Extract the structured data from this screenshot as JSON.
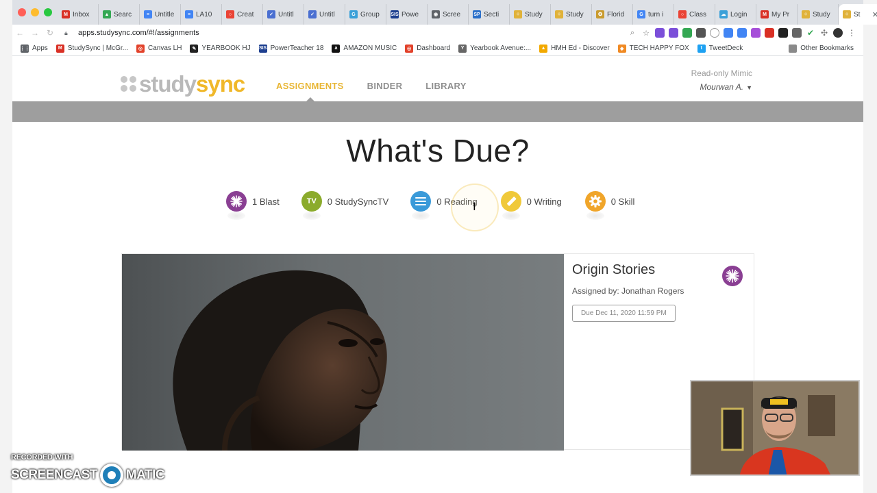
{
  "browser": {
    "tabs": [
      {
        "label": "Inbox",
        "color": "#d93025",
        "glyph": "M"
      },
      {
        "label": "Searc",
        "color": "#34a853",
        "glyph": "▲"
      },
      {
        "label": "Untitle",
        "color": "#4285f4",
        "glyph": "≡"
      },
      {
        "label": "LA10",
        "color": "#4285f4",
        "glyph": "≡"
      },
      {
        "label": "Creat",
        "color": "#ea4335",
        "glyph": "○"
      },
      {
        "label": "Untitl",
        "color": "#4a6fd1",
        "glyph": "✓"
      },
      {
        "label": "Untitl",
        "color": "#4a6fd1",
        "glyph": "✓"
      },
      {
        "label": "Group",
        "color": "#3aa0d8",
        "glyph": "G"
      },
      {
        "label": "Powe",
        "color": "#1d3f8f",
        "glyph": "SIS"
      },
      {
        "label": "Scree",
        "color": "#5f6368",
        "glyph": "◉"
      },
      {
        "label": "Secti",
        "color": "#2a6fc9",
        "glyph": "SP"
      },
      {
        "label": "Study",
        "color": "#e0b23a",
        "glyph": "⁘"
      },
      {
        "label": "Study",
        "color": "#e0b23a",
        "glyph": "⁘"
      },
      {
        "label": "Florid",
        "color": "#c99b2e",
        "glyph": "✪"
      },
      {
        "label": "turn i",
        "color": "#4285f4",
        "glyph": "G"
      },
      {
        "label": "Class",
        "color": "#ea4335",
        "glyph": "○"
      },
      {
        "label": "Login",
        "color": "#3aa0d8",
        "glyph": "☁"
      },
      {
        "label": "My Pr",
        "color": "#d93025",
        "glyph": "M"
      },
      {
        "label": "Study",
        "color": "#e0b23a",
        "glyph": "⁘"
      },
      {
        "label": "St",
        "color": "#e0b23a",
        "glyph": "⁘",
        "active": true
      }
    ],
    "new_tab_glyph": "+",
    "url": "apps.studysync.com/#!/assignments",
    "bookmarks": [
      {
        "label": "Apps",
        "color": "#5f6368",
        "glyph": "⋮⋮"
      },
      {
        "label": "StudySync | McGr...",
        "color": "#d93025",
        "glyph": "M"
      },
      {
        "label": "Canvas LH",
        "color": "#e2422b",
        "glyph": "◎"
      },
      {
        "label": "YEARBOOK HJ",
        "color": "#222",
        "glyph": "✎"
      },
      {
        "label": "PowerTeacher 18",
        "color": "#1d3f8f",
        "glyph": "SIS"
      },
      {
        "label": "AMAZON MUSIC",
        "color": "#111",
        "glyph": "a"
      },
      {
        "label": "Dashboard",
        "color": "#e2422b",
        "glyph": "◎"
      },
      {
        "label": "Yearbook Avenue:...",
        "color": "#666",
        "glyph": "Y"
      },
      {
        "label": "HMH Ed - Discover",
        "color": "#f2a900",
        "glyph": "▲"
      },
      {
        "label": "TECH HAPPY FOX",
        "color": "#f08a24",
        "glyph": "◆"
      },
      {
        "label": "TweetDeck",
        "color": "#1da1f2",
        "glyph": "t"
      }
    ],
    "other_bookmarks": "Other Bookmarks"
  },
  "header": {
    "logo_study": "study",
    "logo_sync": "sync",
    "nav": [
      {
        "label": "ASSIGNMENTS",
        "active": true
      },
      {
        "label": "BINDER",
        "active": false
      },
      {
        "label": "LIBRARY",
        "active": false
      }
    ],
    "read_only": "Read-only Mimic",
    "user": "Mourwan A."
  },
  "main": {
    "title": "What's Due?",
    "filters": [
      {
        "label": "1 Blast",
        "color": "#8a3f93",
        "icon": "blast-icon"
      },
      {
        "label": "0 StudySyncTV",
        "color": "#8bab2c",
        "icon": "tv-icon",
        "glyph": "TV"
      },
      {
        "label": "0 Reading",
        "color": "#3a9ad9",
        "icon": "reading-icon"
      },
      {
        "label": "0 Writing",
        "color": "#f0c93a",
        "icon": "writing-icon"
      },
      {
        "label": "0 Skill",
        "color": "#f0a52a",
        "icon": "skill-icon"
      }
    ],
    "assignment": {
      "title": "Origin Stories",
      "assigned_by": "Assigned by: Jonathan Rogers",
      "due": "Due Dec 11, 2020 11:59 PM"
    }
  },
  "overlay": {
    "watermark_top": "RECORDED WITH",
    "watermark_left": "SCREENCAST",
    "watermark_right": "MATIC"
  }
}
